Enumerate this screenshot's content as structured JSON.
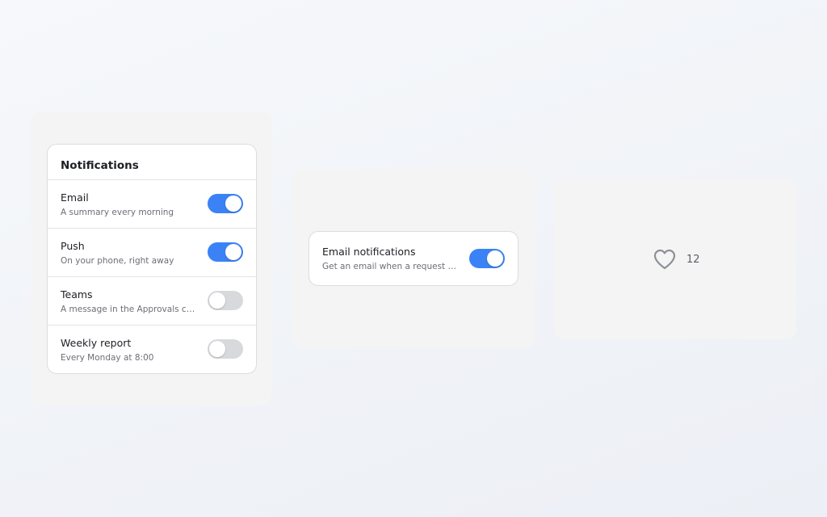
{
  "notifications_card": {
    "title": "Notifications",
    "items": [
      {
        "label": "Email",
        "description": "A summary every morning",
        "enabled": true
      },
      {
        "label": "Push",
        "description": "On your phone, right away",
        "enabled": true
      },
      {
        "label": "Teams",
        "description": "A message in the Approvals channel",
        "enabled": false
      },
      {
        "label": "Weekly report",
        "description": "Every Monday at 8:00",
        "enabled": false
      }
    ]
  },
  "email_setting": {
    "label": "Email notifications",
    "description": "Get an email when a request needs your approval",
    "enabled": true
  },
  "like": {
    "icon": "heart-outline-icon",
    "count": "12"
  },
  "colors": {
    "toggle_on": "#3b82f6",
    "toggle_off": "#d8d9dd",
    "icon_stroke": "#8d9098"
  }
}
